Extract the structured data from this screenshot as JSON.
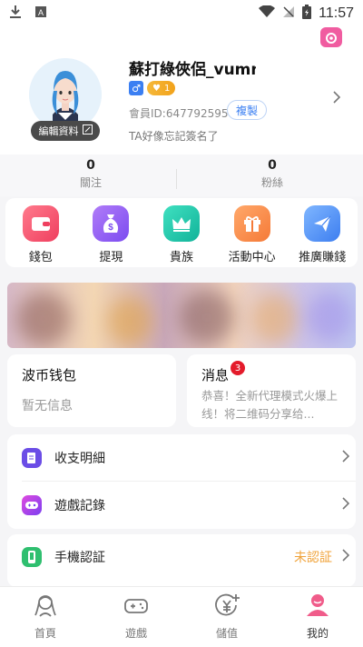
{
  "status_bar": {
    "time": "11:57"
  },
  "profile": {
    "username": "蘇打綠俠侶_vumn",
    "gender_icon": "male-icon",
    "level": "1",
    "member_id": "會員ID:647792595",
    "copy_label": "複製",
    "edit_label": "編輯資料",
    "signature": "TA好像忘記簽名了"
  },
  "stats": {
    "following": {
      "value": "0",
      "label": "關注"
    },
    "fans": {
      "value": "0",
      "label": "粉絲"
    }
  },
  "menu": [
    {
      "label": "錢包",
      "icon": "wallet-icon",
      "color": "#f0506e"
    },
    {
      "label": "提現",
      "icon": "money-bag-icon",
      "color": "#8a5cf5"
    },
    {
      "label": "貴族",
      "icon": "crown-icon",
      "color": "#20c3a8"
    },
    {
      "label": "活動中心",
      "icon": "gift-icon",
      "color": "#f7904a"
    },
    {
      "label": "推廣賺錢",
      "icon": "paper-plane-icon",
      "color": "#4e90f5"
    }
  ],
  "wallet_card": {
    "title": "波币钱包",
    "body": "暂无信息"
  },
  "message_card": {
    "title": "消息",
    "badge": "3",
    "body": "恭喜！全新代理模式火爆上线！将二维码分享给..."
  },
  "list1": [
    {
      "label": "收支明細",
      "icon": "document-icon",
      "color": "#6b4de6"
    },
    {
      "label": "遊戲記錄",
      "icon": "gamepad-icon",
      "color": "#7b3ff0"
    }
  ],
  "list2": [
    {
      "label": "手機認証",
      "icon": "phone-icon",
      "color": "#2fbf6f",
      "status": "未認証"
    }
  ],
  "tabs": [
    {
      "label": "首頁",
      "icon": "home-girl-icon"
    },
    {
      "label": "遊戲",
      "icon": "game-controller-icon"
    },
    {
      "label": "儲值",
      "icon": "yen-coin-icon"
    },
    {
      "label": "我的",
      "icon": "user-icon"
    }
  ],
  "colors": {
    "accent": "#3b7ff2",
    "warning": "#f0a33a",
    "active_tab": "#f05c8a"
  }
}
